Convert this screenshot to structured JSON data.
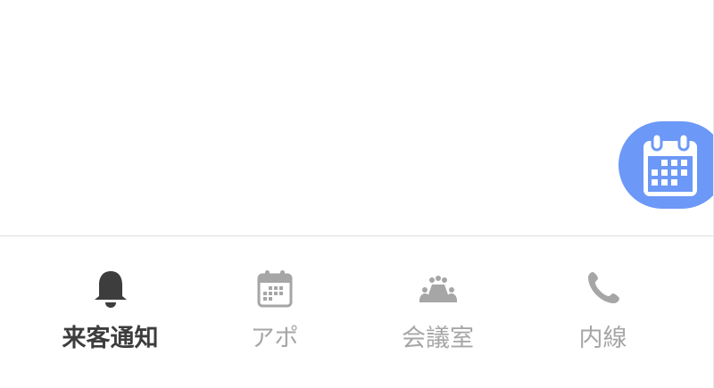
{
  "fab": {
    "icon": "calendar-icon",
    "color": "#6c98f7"
  },
  "tabbar": {
    "active_color": "#3d3d3d",
    "inactive_color": "#a6a6a6",
    "items": [
      {
        "label": "来客通知",
        "icon": "bell-icon",
        "active": true
      },
      {
        "label": "アポ",
        "icon": "calendar-icon",
        "active": false
      },
      {
        "label": "会議室",
        "icon": "meeting-room-icon",
        "active": false
      },
      {
        "label": "内線",
        "icon": "phone-icon",
        "active": false
      }
    ]
  }
}
